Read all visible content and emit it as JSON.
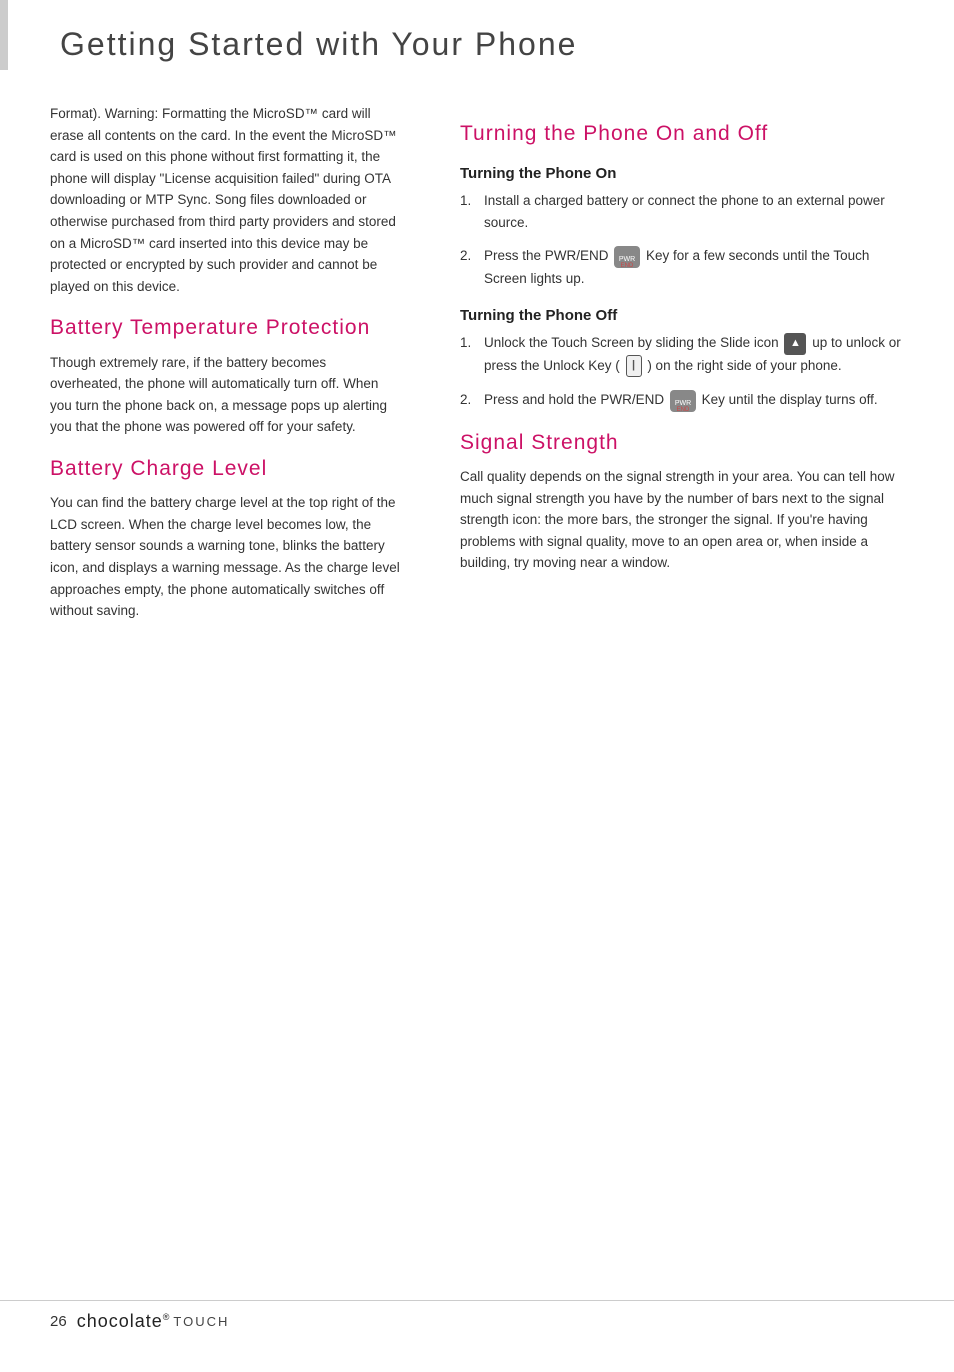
{
  "header": {
    "title": "Getting Started with Your Phone",
    "accent": true
  },
  "left_col": {
    "intro_text": "Format). Warning: Formatting the MicroSD™ card will erase all contents on the card. In the event the MicroSD™ card is used on this phone without first formatting it, the phone will display \"License acquisition failed\" during OTA downloading or MTP Sync. Song files downloaded or otherwise purchased from third party providers and stored on a MicroSD™ card inserted into this device may be protected or encrypted by such provider and cannot be played on this device.",
    "battery_temp_heading": "Battery Temperature Protection",
    "battery_temp_text": "Though extremely rare, if the battery becomes overheated, the phone will automatically turn off. When you turn the phone back on, a message pops up alerting you that the phone was powered off for your safety.",
    "battery_charge_heading": "Battery Charge Level",
    "battery_charge_text": "You can find the battery charge level at the top right of the LCD screen. When the charge level becomes low, the battery sensor sounds a warning tone, blinks the battery icon, and displays a warning message. As the charge level approaches empty, the phone automatically switches off without saving."
  },
  "right_col": {
    "turning_heading": "Turning the Phone On and Off",
    "turning_on_subheading": "Turning the Phone On",
    "turning_on_steps": [
      {
        "num": "1.",
        "text": "Install a charged battery or connect the phone to an external power source."
      },
      {
        "num": "2.",
        "text": "Press the PWR/END",
        "has_pwr_icon": true,
        "text_after": "Key for a few seconds until the Touch Screen lights up."
      }
    ],
    "turning_off_subheading": "Turning the Phone Off",
    "turning_off_steps": [
      {
        "num": "1.",
        "text": "Unlock the Touch Screen by sliding the Slide icon",
        "has_slide_icon": true,
        "text_after": "up to unlock or press the Unlock Key (",
        "has_unlock_key": true,
        "text_end": ") on the right side of your phone."
      },
      {
        "num": "2.",
        "text": "Press and hold the PWR/END",
        "has_pwr_icon": true,
        "text_after": "Key until the display turns off."
      }
    ],
    "signal_heading": "Signal Strength",
    "signal_text": "Call quality depends on the signal strength in your area. You can tell how much signal strength you have by the number of bars next to the signal strength icon: the more bars, the stronger the signal. If you're having problems with signal quality, move to an open area or, when inside a building, try moving near a window."
  },
  "footer": {
    "page_num": "26",
    "brand_name": "chocolate",
    "brand_suffix": "TOUCH",
    "brand_dot": "®"
  }
}
